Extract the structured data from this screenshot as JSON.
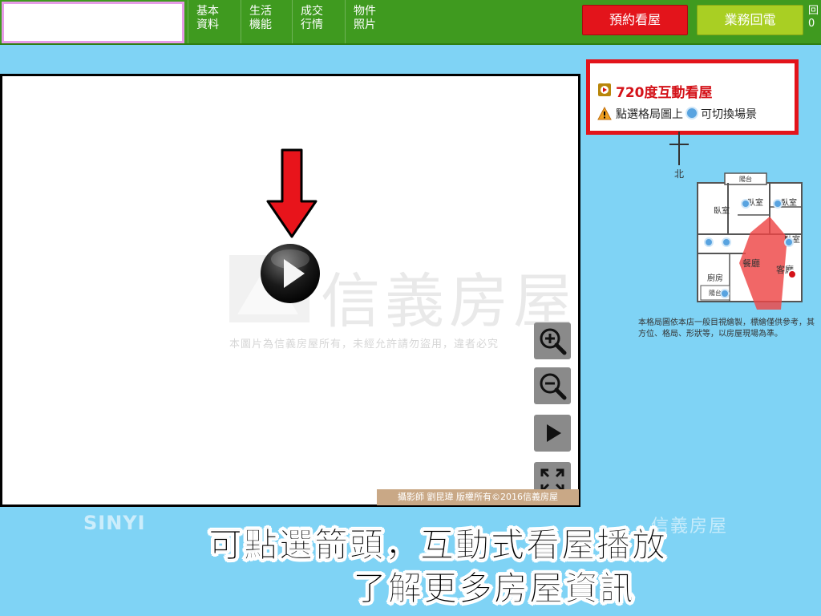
{
  "topbar": {
    "tabs": [
      {
        "line1": "基本",
        "line2": "資料"
      },
      {
        "line1": "生活",
        "line2": "機能"
      },
      {
        "line1": "成交",
        "line2": "行情"
      },
      {
        "line1": "物件",
        "line2": "照片"
      }
    ],
    "appointment_label": "預約看屋",
    "callback_label": "業務回電",
    "edge_text": "回 0"
  },
  "viewer": {
    "photo_credit": "攝影師 劉昆瑋 版權所有©2016信義房屋",
    "watermark_main": "信義房屋",
    "watermark_sub": "本圖片為信義房屋所有，未經允許請勿盜用，違者必究",
    "controls": [
      "zoom-in",
      "zoom-out",
      "play",
      "fullscreen"
    ]
  },
  "info_panel": {
    "title": "720度互動看屋",
    "hint_before": "點選格局圖上",
    "hint_after": "可切換場景"
  },
  "floorplan": {
    "north_label": "北",
    "rooms": [
      "陽台",
      "臥室",
      "臥室",
      "臥室",
      "臥室",
      "餐廳",
      "客廳",
      "廚房",
      "陽台"
    ],
    "note": "本格局圖依本店一般目視繪製，標繪僅供參考，其方位、格局、形狀等，以房屋現場為準。"
  },
  "watermarks": {
    "left": "SINYI",
    "right": "信義房屋"
  },
  "caption": {
    "line1": "可點選箭頭，互動式看屋播放",
    "line2": "了解更多房屋資訊"
  },
  "colors": {
    "topbar": "#3f9a1f",
    "background": "#7fd3f5",
    "appointment_button": "#e3141b",
    "callback_button": "#a9cf23",
    "highlight_red": "#e3141b",
    "hotspot_blue": "#58a3e0"
  }
}
